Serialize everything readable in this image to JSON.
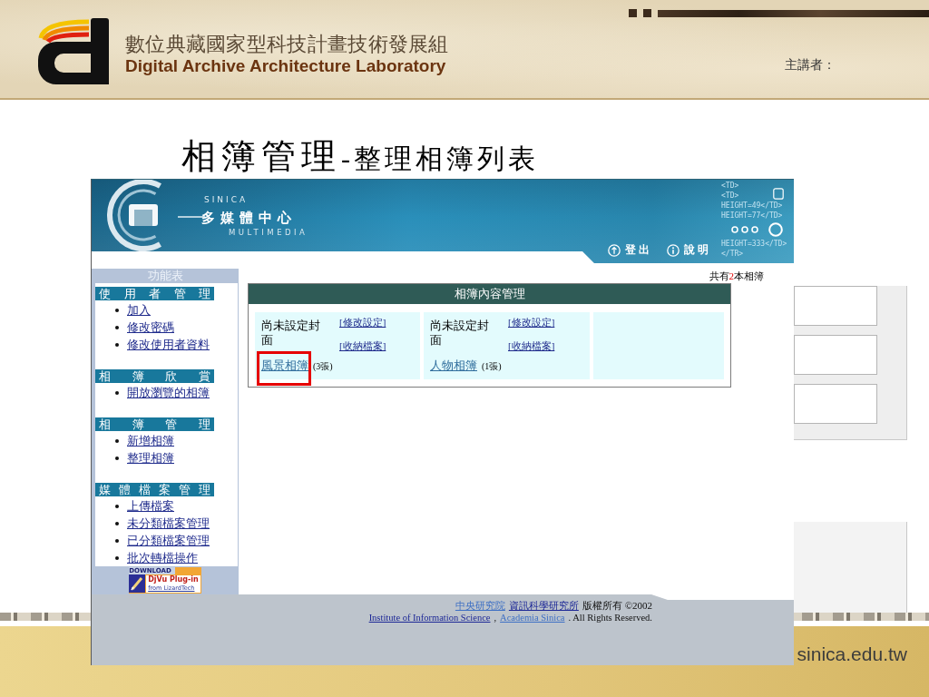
{
  "header": {
    "title_zh": "數位典藏國家型科技計畫技術發展組",
    "title_en": "Digital Archive Architecture Laboratory",
    "speaker_label": "主講者："
  },
  "slide_title": {
    "main": "相簿管理",
    "sub": "-整理相簿列表"
  },
  "screenshot": {
    "banner": {
      "brand_top": "SINICA",
      "brand_name": "多媒體中心",
      "brand_bottom": "MULTIMEDIA",
      "code_lines": [
        "<TD>",
        "<TD>",
        "HEIGHT=49</TD>",
        "HEIGHT=77</TD>",
        "HEIGHT=333</TD>",
        "</TR>"
      ],
      "actions": [
        {
          "kind": "logout",
          "label": "登出"
        },
        {
          "kind": "help",
          "label": "說明"
        }
      ]
    },
    "sidebar": {
      "title": "功能表",
      "sections": [
        {
          "heading": "使用者管理",
          "items": [
            "加入",
            "修改密碼",
            "修改使用者資料"
          ]
        },
        {
          "heading": "相簿欣賞",
          "items": [
            "開放瀏覽的相簿"
          ]
        },
        {
          "heading": "相簿管理",
          "items": [
            "新增相簿",
            "整理相簿"
          ]
        },
        {
          "heading": "媒體檔案管理",
          "items": [
            "上傳檔案",
            "未分類檔案管理",
            "已分類檔案管理",
            "批次轉檔操作"
          ]
        }
      ],
      "download_badge": {
        "top": "DOWNLOAD",
        "name": "DjVu Plug-in",
        "vendor": "from LizardTech"
      }
    },
    "album_count": {
      "before": "共有",
      "number": "2",
      "after": "本相簿"
    },
    "panel": {
      "title": "相簿內容管理",
      "cells": [
        {
          "kind": "album",
          "cover_text": "尚未設定封面",
          "links": [
            "[修改設定]",
            "[收納檔案]"
          ],
          "name": "風景相簿",
          "photo_count": "(3張)",
          "highlighted": true
        },
        {
          "kind": "album",
          "cover_text": "尚未設定封面",
          "links": [
            "[修改設定]",
            "[收納檔案]"
          ],
          "name": "人物相簿",
          "photo_count": "(1張)",
          "highlighted": false
        },
        {
          "kind": "empty"
        }
      ]
    },
    "footer": {
      "lines": [
        {
          "parts": [
            {
              "kind": "link",
              "text": "中央研究院",
              "color": "#3d6fc4"
            },
            {
              "kind": "link",
              "text": "資訊科學研究所",
              "color": "#1c2796"
            },
            {
              "kind": "text",
              "text": "版權所有 ©2002"
            }
          ]
        },
        {
          "parts": [
            {
              "kind": "link",
              "text": "Institute of Information Science",
              "color": "#1c2796"
            },
            {
              "kind": "text",
              "text": ","
            },
            {
              "kind": "link",
              "text": "Academia Sinica",
              "color": "#3d6fc4"
            },
            {
              "kind": "text",
              "text": ". All Rights Reserved."
            }
          ]
        }
      ]
    }
  },
  "bottom_band": {
    "url": "sinica.edu.tw"
  }
}
